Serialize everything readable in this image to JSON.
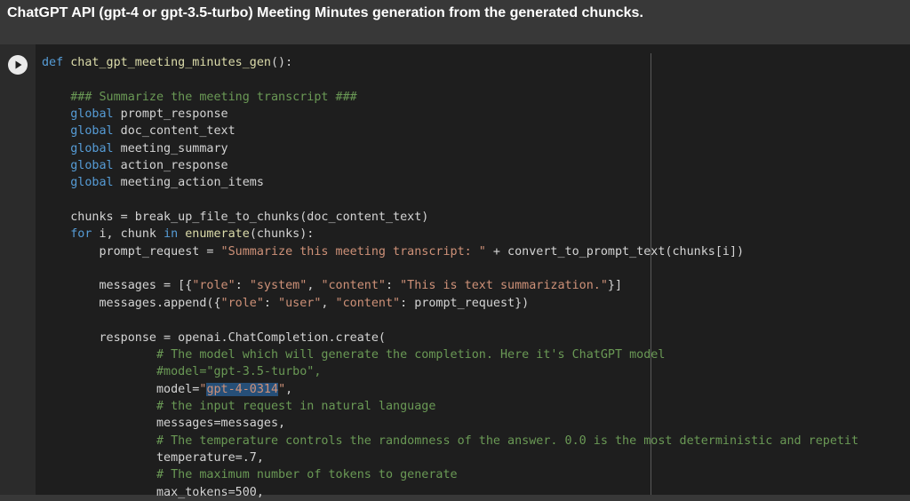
{
  "header": {
    "title": "ChatGPT API (gpt-4 or gpt-3.5-turbo) Meeting Minutes generation from the generated chuncks."
  },
  "cell": {
    "run_button_icon": "play-icon",
    "colors": {
      "background": "#1e1e1e",
      "keyword": "#569cd6",
      "function": "#dcdcaa",
      "string": "#ce9178",
      "comment": "#6a9955",
      "selection": "#264f78"
    },
    "code_lines": [
      "def chat_gpt_meeting_minutes_gen():",
      "",
      "    ### Summarize the meeting transcript ###",
      "    global prompt_response",
      "    global doc_content_text",
      "    global meeting_summary",
      "    global action_response",
      "    global meeting_action_items",
      "",
      "    chunks = break_up_file_to_chunks(doc_content_text)",
      "    for i, chunk in enumerate(chunks):",
      "        prompt_request = \"Summarize this meeting transcript: \" + convert_to_prompt_text(chunks[i])",
      "",
      "        messages = [{\"role\": \"system\", \"content\": \"This is text summarization.\"}]",
      "        messages.append({\"role\": \"user\", \"content\": prompt_request})",
      "",
      "        response = openai.ChatCompletion.create(",
      "                # The model which will generate the completion. Here it's ChatGPT model",
      "                #model=\"gpt-3.5-turbo\",",
      "                model=\"gpt-4-0314\",",
      "                # the input request in natural language",
      "                messages=messages,",
      "                # The temperature controls the randomness of the answer. 0.0 is the most deterministic and repetit",
      "                temperature=.7,",
      "                # The maximum number of tokens to generate",
      "                max_tokens=500,"
    ]
  }
}
